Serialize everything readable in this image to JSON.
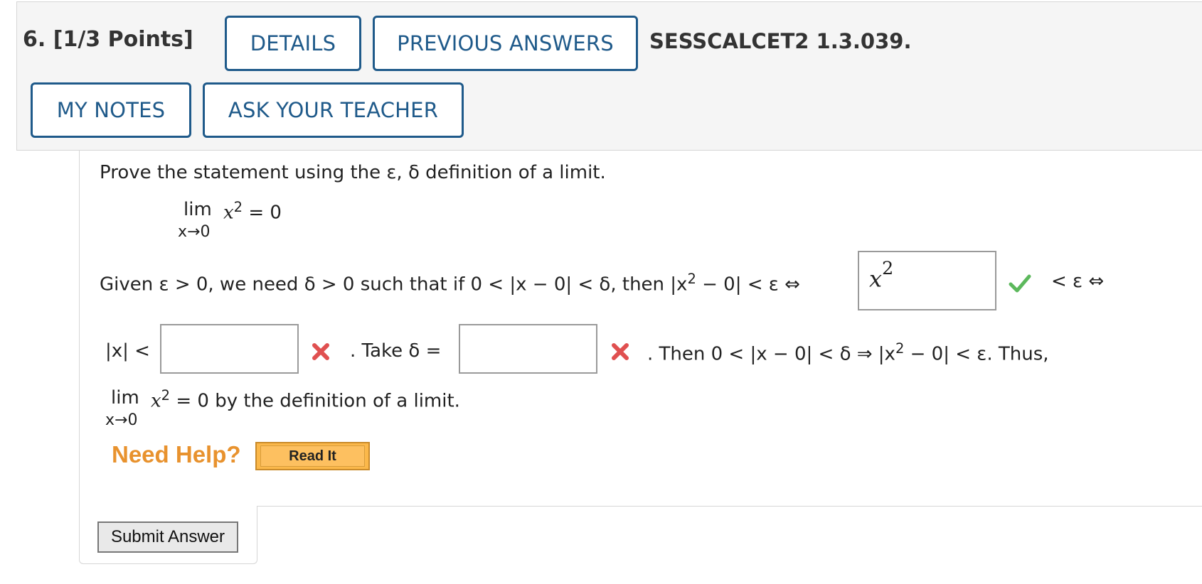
{
  "header": {
    "question_number": "6.",
    "points": "[1/3 Points]",
    "details_label": "DETAILS",
    "previous_answers_label": "PREVIOUS ANSWERS",
    "problem_code": "SESSCALCET2 1.3.039.",
    "my_notes_label": "MY NOTES",
    "ask_teacher_label": "ASK YOUR TEACHER"
  },
  "question": {
    "prompt": "Prove the statement using the ε, δ definition of a limit.",
    "limit_word": "lim",
    "limit_sub": "x→0",
    "limit_expr_base": "x",
    "limit_expr_exp": "2",
    "limit_expr_rhs": "= 0",
    "line1_lead": "Given ε > 0, we need δ > 0 such that if  0 < |x − 0| < δ,  then  |x",
    "line1_exp": "2",
    "line1_tail": " − 0| < ε ⇔",
    "after_box1": "< ε ⇔",
    "line2_lead": "|x| <",
    "take_text": ".  Take  δ =",
    "then_text_lead": ".  Then  0 < |x − 0| < δ ⇒   |x",
    "then_exp": "2",
    "then_text_tail": " − 0| < ε.  Thus,",
    "conclusion_tail": "= 0  by the definition of a limit."
  },
  "answers": {
    "box1_value_base": "x",
    "box1_value_exp": "2",
    "box1_status": "correct",
    "box2_value": "",
    "box2_status": "incorrect",
    "box3_value": "",
    "box3_status": "incorrect"
  },
  "help": {
    "label": "Need Help?",
    "read_it_label": "Read It"
  },
  "submit_label": "Submit Answer",
  "colors": {
    "button_border": "#1f5a8a",
    "correct": "#5cb85c",
    "incorrect": "#e05050",
    "help_text": "#e8922e"
  }
}
